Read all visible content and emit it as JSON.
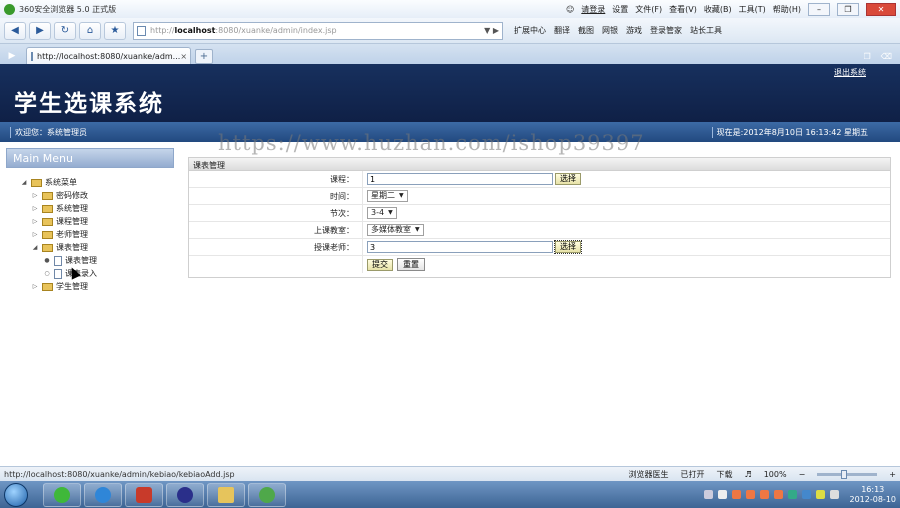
{
  "browser": {
    "title": "360安全浏览器 5.0 正式版",
    "menu": [
      "设置",
      "文件(F)",
      "查看(V)",
      "收藏(B)",
      "工具(T)",
      "帮助(H)"
    ],
    "login_label": "请登录",
    "address_prefix": "http://",
    "address_host": "localhost",
    "address_rest": ":8080/xuanke/admin/index.jsp",
    "toolbar_items": [
      "扩展中心",
      "翻译",
      "截图",
      "网银",
      "游戏",
      "登录管家",
      "站长工具"
    ],
    "tab_title": "http://localhost:8080/xuanke/adm...",
    "close_glyph": "×",
    "new_tab_glyph": "+"
  },
  "page": {
    "logout": "退出系统",
    "system_title": "学生选课系统",
    "welcome": "欢迎您：系统管理员",
    "datetime": "现在是:2012年8月10日 16:13:42 星期五",
    "watermark": "https://www.huzhan.com/ishop39397",
    "sidebar": {
      "header": "Main Menu",
      "tree": [
        {
          "label": "系统菜单",
          "level": 0,
          "expanded": true,
          "kind": "folder"
        },
        {
          "label": "密码修改",
          "level": 1,
          "expanded": false,
          "kind": "folder"
        },
        {
          "label": "系统管理",
          "level": 1,
          "expanded": false,
          "kind": "folder"
        },
        {
          "label": "课程管理",
          "level": 1,
          "expanded": false,
          "kind": "folder"
        },
        {
          "label": "老师管理",
          "level": 1,
          "expanded": false,
          "kind": "folder"
        },
        {
          "label": "课表管理",
          "level": 1,
          "expanded": true,
          "kind": "folder"
        },
        {
          "label": "课表管理",
          "level": 2,
          "kind": "file"
        },
        {
          "label": "课表录入",
          "level": 2,
          "kind": "file"
        },
        {
          "label": "学生管理",
          "level": 1,
          "expanded": false,
          "kind": "folder"
        }
      ]
    },
    "form": {
      "title": "课表管理",
      "fields": {
        "course": {
          "label": "课程：",
          "value": "1",
          "button": "选择"
        },
        "time": {
          "label": "时间：",
          "value": "星期二"
        },
        "section": {
          "label": "节次：",
          "value": "3-4"
        },
        "classroom": {
          "label": "上课教室：",
          "value": "多媒体教室"
        },
        "teacher": {
          "label": "授课老师：",
          "value": "3",
          "button": "选择"
        }
      },
      "submit": "提交",
      "reset": "重置"
    }
  },
  "statusbar": {
    "url": "http://localhost:8080/xuanke/admin/kebiao/kebiaoAdd.jsp",
    "items": [
      "浏览器医生",
      "已打开",
      "下载"
    ],
    "zoom": "100%"
  },
  "taskbar": {
    "time": "16:13",
    "date": "2012-08-10"
  },
  "colors": {
    "header_bg": "#17305e",
    "infobar_bg": "#2e5a94",
    "button_bg": "#f3efc0"
  }
}
